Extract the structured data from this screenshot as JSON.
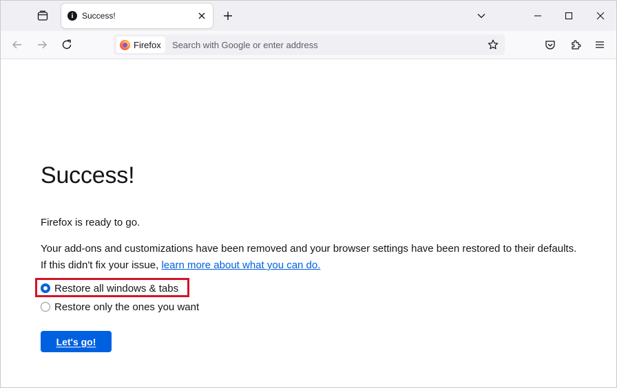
{
  "tab": {
    "title": "Success!",
    "icon": "info-icon"
  },
  "urlbar": {
    "identity_label": "Firefox",
    "placeholder": "Search with Google or enter address"
  },
  "page": {
    "heading": "Success!",
    "ready_text": "Firefox is ready to go.",
    "description_line1": "Your add-ons and customizations have been removed and your browser settings have been restored to their defaults.",
    "description_line2_prefix": "If this didn't fix your issue, ",
    "learn_more_link": "learn more about what you can do.",
    "options": [
      {
        "label": "Restore all windows & tabs",
        "selected": true
      },
      {
        "label": "Restore only the ones you want",
        "selected": false
      }
    ],
    "go_button": "Let's go!"
  },
  "colors": {
    "accent": "#0061e0",
    "highlight_border": "#d1132a",
    "tab_strip": "#f0f0f4"
  }
}
